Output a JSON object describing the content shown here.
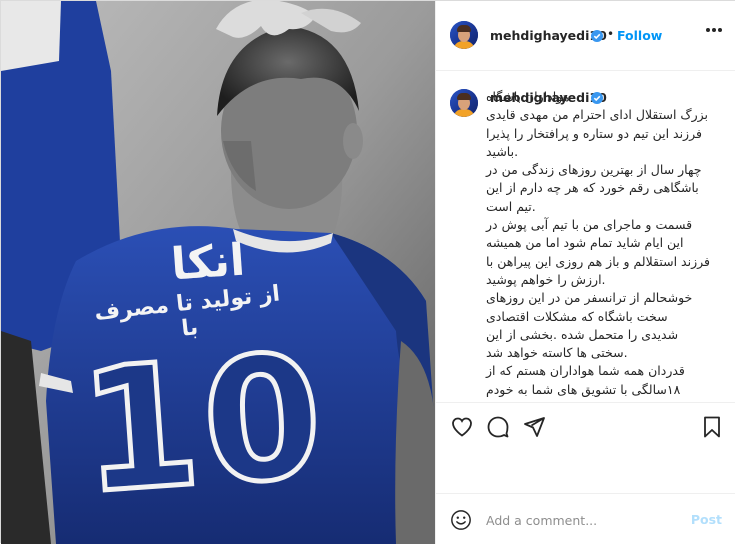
{
  "header": {
    "username": "mehdighayedi10",
    "separator": "•",
    "follow_label": "Follow",
    "more_icon": "more-horizontal-icon"
  },
  "photo": {
    "description_icon": "jersey-photo",
    "jersey_title": "انکا",
    "jersey_slogan": "از تولید تا مصرف با",
    "jersey_number": "10",
    "colors": {
      "jersey": "#1d3a8f",
      "background": "#a3a3a3"
    }
  },
  "caption": {
    "username": "mehdighayedi10",
    "text": "هواداران باشگاه\nبزرگ استقلال ادای احترام من مهدی قایدی\nفرزند این تیم دو ستاره و پرافتخار را پذیرا\n.باشید\nچهار سال از بهترین روزهای زندگی من در\nباشگاهی رقم خورد که هر چه دارم از این\n.تیم است\nقسمت و ماجرای من با تیم آبی پوش در\nاین ایام شاید تمام شود اما من همیشه\nفرزند استقلالم و باز هم روزی این پیراهن با\n.ارزش را خواهم پوشید\nخوشحالم از ترانسفر من در این روزهای\nسخت باشگاه که مشکلات اقتصادی\nشدیدی را متحمل شده .بخشی از این\n.سختی ها کاسته خواهد شد\nقدردان همه شما هواداران هستم که از\n۱۸سالگی با تشویق های شما به خودم\n.بالیدم\n🙏🙏🙏🙏🙏\nتشکر ویژه از آقای... آقای ...نظم"
  },
  "actions": {
    "like_icon": "heart-icon",
    "comment_icon": "comment-icon",
    "share_icon": "send-icon",
    "save_icon": "bookmark-icon"
  },
  "comment_box": {
    "emoji_icon": "smiley-icon",
    "placeholder": "Add a comment...",
    "post_label": "Post"
  },
  "colors": {
    "accent": "#0095f6",
    "verified": "#3897f0",
    "post_disabled": "#b2dffc"
  }
}
